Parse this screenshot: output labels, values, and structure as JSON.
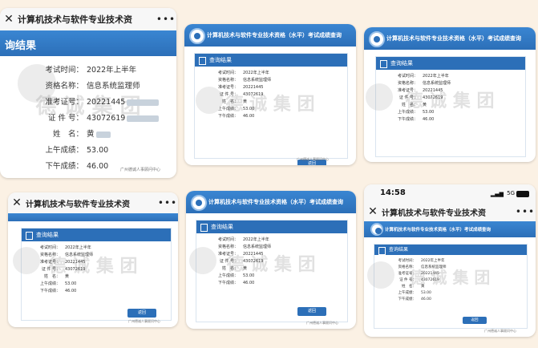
{
  "wx_title": "计算机技术与软件专业技术资",
  "page_title": "计算机技术与软件专业技术资格（水平）考试成绩查询",
  "panel_title": "查询结果",
  "watermark": "德 诚 集 团",
  "back_label": "返回",
  "footer": "广州德诚人事顾问中心",
  "status_time": "14:58",
  "status_net": "5G",
  "card1": {
    "header": "询结果",
    "rows": [
      {
        "label": "考试时间：",
        "value": "2022年上半年"
      },
      {
        "label": "资格名称：",
        "value": "信息系统监理师"
      },
      {
        "label": "准考证号：",
        "value": "20221445"
      },
      {
        "label": "证 件 号：",
        "value": "43072619"
      },
      {
        "label": "姓　名：",
        "value": "黄"
      },
      {
        "label": "上午成绩：",
        "value": "53.00"
      },
      {
        "label": "下午成绩：",
        "value": "46.00"
      }
    ]
  },
  "small_rows": [
    {
      "label": "考试时间：",
      "value": "2022年上半年"
    },
    {
      "label": "资格名称：",
      "value": "信息系统监理师"
    },
    {
      "label": "准考证号：",
      "value": "20221445"
    },
    {
      "label": "证 件 号：",
      "value": "43072619"
    },
    {
      "label": "姓　名：",
      "value": "黄"
    },
    {
      "label": "上午成绩：",
      "value": "53.00"
    },
    {
      "label": "下午成绩：",
      "value": "46.00"
    }
  ]
}
